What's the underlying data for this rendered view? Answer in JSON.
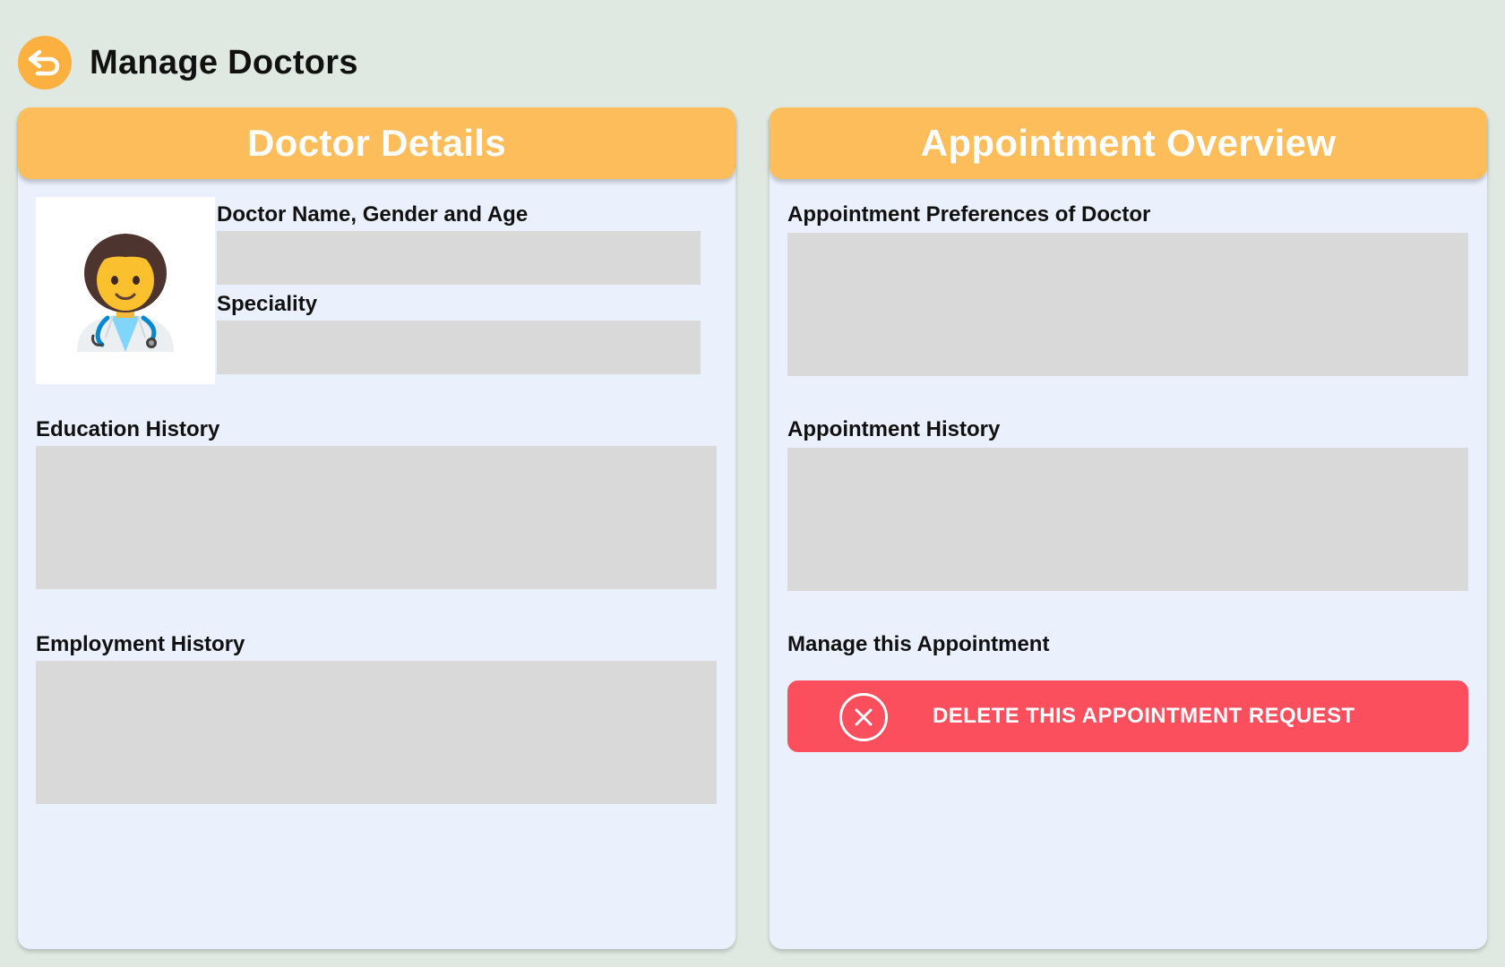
{
  "header": {
    "title": "Manage Doctors",
    "back_icon": "back-arrow-icon"
  },
  "doctor_details": {
    "title": "Doctor Details",
    "avatar_icon": "health-worker-emoji",
    "name_label": "Doctor Name, Gender and Age",
    "name_value": "",
    "speciality_label": "Speciality",
    "speciality_value": "",
    "education_label": "Education History",
    "education_value": "",
    "employment_label": "Employment History",
    "employment_value": ""
  },
  "appointment_overview": {
    "title": "Appointment Overview",
    "preferences_label": "Appointment Preferences of Doctor",
    "preferences_value": "",
    "history_label": "Appointment History",
    "history_value": "",
    "manage_label": "Manage this Appointment",
    "delete_button_label": "DELETE THIS APPOINTMENT REQUEST",
    "delete_icon": "close-circle-icon"
  },
  "colors": {
    "background": "#dfe8e1",
    "accent": "#fdbd5a",
    "back_button": "#fbb040",
    "panel": "#ebf0fd",
    "field": "#d9d9d9",
    "danger": "#fc4f5e"
  }
}
